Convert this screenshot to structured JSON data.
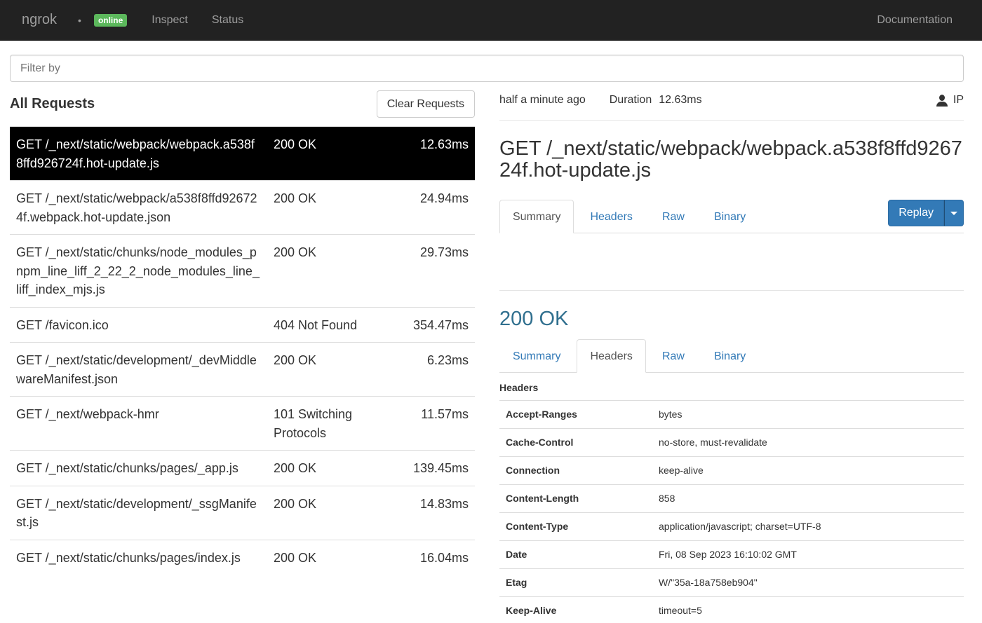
{
  "nav": {
    "brand": "ngrok",
    "dot": "•",
    "status": "online",
    "links": [
      "Inspect",
      "Status"
    ],
    "documentation": "Documentation"
  },
  "filter": {
    "placeholder": "Filter by"
  },
  "requests": {
    "title": "All Requests",
    "clear_label": "Clear Requests",
    "rows": [
      {
        "path": "GET /_next/static/webpack/webpack.a538f8ffd926724f.hot-update.js",
        "status": "200 OK",
        "duration": "12.63ms"
      },
      {
        "path": "GET /_next/static/webpack/a538f8ffd926724f.webpack.hot-update.json",
        "status": "200 OK",
        "duration": "24.94ms"
      },
      {
        "path": "GET /_next/static/chunks/node_modules_pnpm_line_liff_2_22_2_node_modules_line_liff_index_mjs.js",
        "status": "200 OK",
        "duration": "29.73ms"
      },
      {
        "path": "GET /favicon.ico",
        "status": "404 Not Found",
        "duration": "354.47ms"
      },
      {
        "path": "GET /_next/static/development/_devMiddlewareManifest.json",
        "status": "200 OK",
        "duration": "6.23ms"
      },
      {
        "path": "GET /_next/webpack-hmr",
        "status": "101 Switching Protocols",
        "duration": "11.57ms"
      },
      {
        "path": "GET /_next/static/chunks/pages/_app.js",
        "status": "200 OK",
        "duration": "139.45ms"
      },
      {
        "path": "GET /_next/static/development/_ssgManifest.js",
        "status": "200 OK",
        "duration": "14.83ms"
      },
      {
        "path": "GET /_next/static/chunks/pages/index.js",
        "status": "200 OK",
        "duration": "16.04ms"
      }
    ]
  },
  "detail": {
    "timestamp": "half a minute ago",
    "duration_label": "Duration",
    "duration_value": "12.63ms",
    "ip_label": "IP",
    "title": "GET /_next/static/webpack/webpack.a538f8ffd926724f.hot-update.js",
    "request_tabs": [
      "Summary",
      "Headers",
      "Raw",
      "Binary"
    ],
    "replay_label": "Replay",
    "response_status": "200 OK",
    "response_tabs": [
      "Summary",
      "Headers",
      "Raw",
      "Binary"
    ],
    "headers_title": "Headers",
    "headers": [
      {
        "key": "Accept-Ranges",
        "value": "bytes"
      },
      {
        "key": "Cache-Control",
        "value": "no-store, must-revalidate"
      },
      {
        "key": "Connection",
        "value": "keep-alive"
      },
      {
        "key": "Content-Length",
        "value": "858"
      },
      {
        "key": "Content-Type",
        "value": "application/javascript; charset=UTF-8"
      },
      {
        "key": "Date",
        "value": "Fri, 08 Sep 2023 16:10:02 GMT"
      },
      {
        "key": "Etag",
        "value": "W/\"35a-18a758eb904\""
      },
      {
        "key": "Keep-Alive",
        "value": "timeout=5"
      }
    ]
  },
  "colors": {
    "navbar": "#222222",
    "online": "#5cb85c",
    "link": "#337ab7",
    "status_ok": "#31708f"
  }
}
